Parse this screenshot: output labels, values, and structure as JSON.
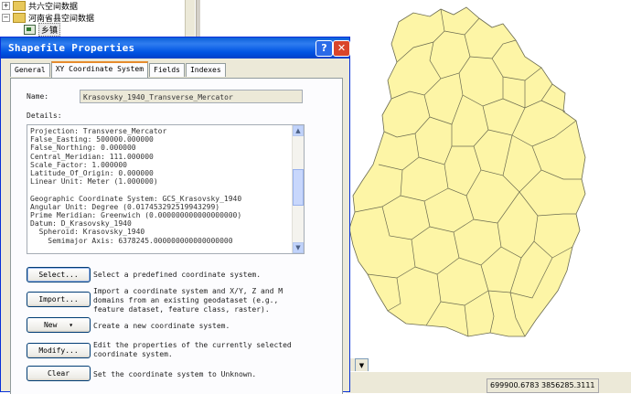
{
  "tree": {
    "items": [
      {
        "expander": "+",
        "label": "共六空间数据"
      },
      {
        "expander": "−",
        "label": "河南省县空间数据"
      },
      {
        "label": "乡镇"
      }
    ]
  },
  "dialog": {
    "title": "Shapefile Properties",
    "help_label": "?",
    "close_label": "✕",
    "tabs": [
      "General",
      "XY Coordinate System",
      "Fields",
      "Indexes"
    ],
    "name_label": "Name:",
    "name_value": "Krasovsky_1940_Transverse_Mercator",
    "details_label": "Details:",
    "details_lines": [
      "Projection: Transverse_Mercator",
      "False_Easting: 500000.000000",
      "False_Northing: 0.000000",
      "Central_Meridian: 111.000000",
      "Scale_Factor: 1.000000",
      "Latitude_Of_Origin: 0.000000",
      "Linear Unit: Meter (1.000000)",
      "",
      "Geographic Coordinate System: GCS_Krasovsky_1940",
      "Angular Unit: Degree (0.017453292519943299)",
      "Prime Meridian: Greenwich (0.000000000000000000)",
      "Datum: D_Krasovsky_1940",
      "  Spheroid: Krasovsky_1940",
      "    Semimajor Axis: 6378245.000000000000000000"
    ],
    "buttons": [
      {
        "label": "Select...",
        "description": "Select a predefined coordinate system."
      },
      {
        "label": "Import...",
        "description": "Import a coordinate system and X/Y, Z and M domains from an existing geodataset (e.g., feature dataset, feature class, raster)."
      },
      {
        "label": "New",
        "arrow": "▾",
        "description": "Create a new coordinate system."
      },
      {
        "label": "Modify...",
        "description": "Edit the properties of the currently selected coordinate system."
      },
      {
        "label": "Clear",
        "description": "Set the coordinate system to Unknown."
      }
    ]
  },
  "status": {
    "coordinates": "699900.6783  3856285.3111",
    "dropdown_arrow": "▼"
  },
  "colors": {
    "map_fill": "#fdf5a6",
    "map_stroke": "#6b6b50",
    "title_bar": "#0054e3",
    "dialog_bg": "#ece9d8"
  }
}
